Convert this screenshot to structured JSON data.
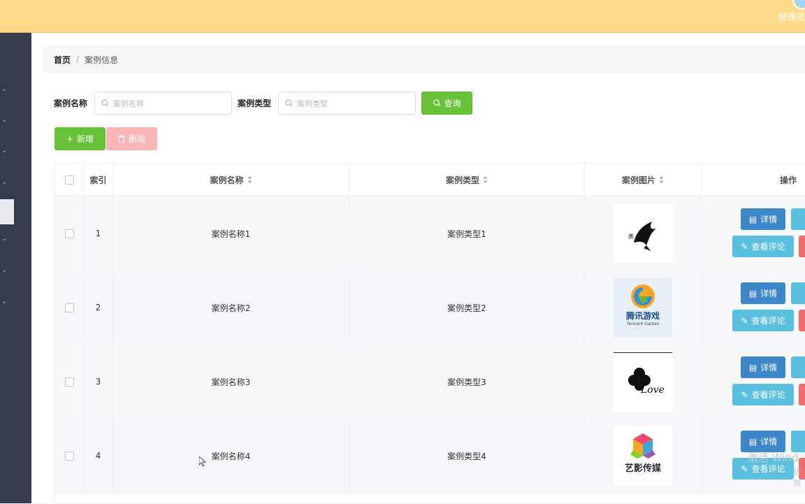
{
  "header": {
    "admin_label": "管理员"
  },
  "breadcrumb": {
    "home": "首页",
    "separator": "/",
    "current": "案例信息"
  },
  "search": {
    "name_label": "案例名称",
    "name_placeholder": "案例名称",
    "type_label": "案例类型",
    "type_placeholder": "案例类型",
    "query_button": "查询"
  },
  "actions": {
    "add_button": "新增",
    "delete_button": "删除"
  },
  "table": {
    "columns": {
      "index": "索引",
      "name": "案例名称",
      "type": "案例类型",
      "image": "案例图片",
      "ops": "操作"
    },
    "rows": [
      {
        "index": "1",
        "name": "案例名称1",
        "type": "案例类型1",
        "image_icon": "bird-logo-icon"
      },
      {
        "index": "2",
        "name": "案例名称2",
        "type": "案例类型2",
        "image_icon": "tencent-games-logo-icon"
      },
      {
        "index": "3",
        "name": "案例名称3",
        "type": "案例类型3",
        "image_icon": "clover-love-logo-icon"
      },
      {
        "index": "4",
        "name": "案例名称4",
        "type": "案例类型4",
        "image_icon": "cube-logo-icon"
      }
    ],
    "row_actions": {
      "detail": "详情",
      "comment": "查看评论"
    }
  },
  "images": {
    "row2_logo_text": "腾讯游戏",
    "row2_logo_sub": "Tencent Games",
    "row3_logo_text": "Love",
    "row4_logo_text": "艺影传媒"
  },
  "watermark": {
    "line1": "激活 Wind",
    "line2": "转到"
  },
  "colors": {
    "topbar": "#ffd98a",
    "sidebar": "#343c4e",
    "success": "#67c23a",
    "danger_light": "#fab6b6",
    "primary": "#3d86c8",
    "info": "#5bbfe0",
    "danger": "#f36b6b"
  }
}
